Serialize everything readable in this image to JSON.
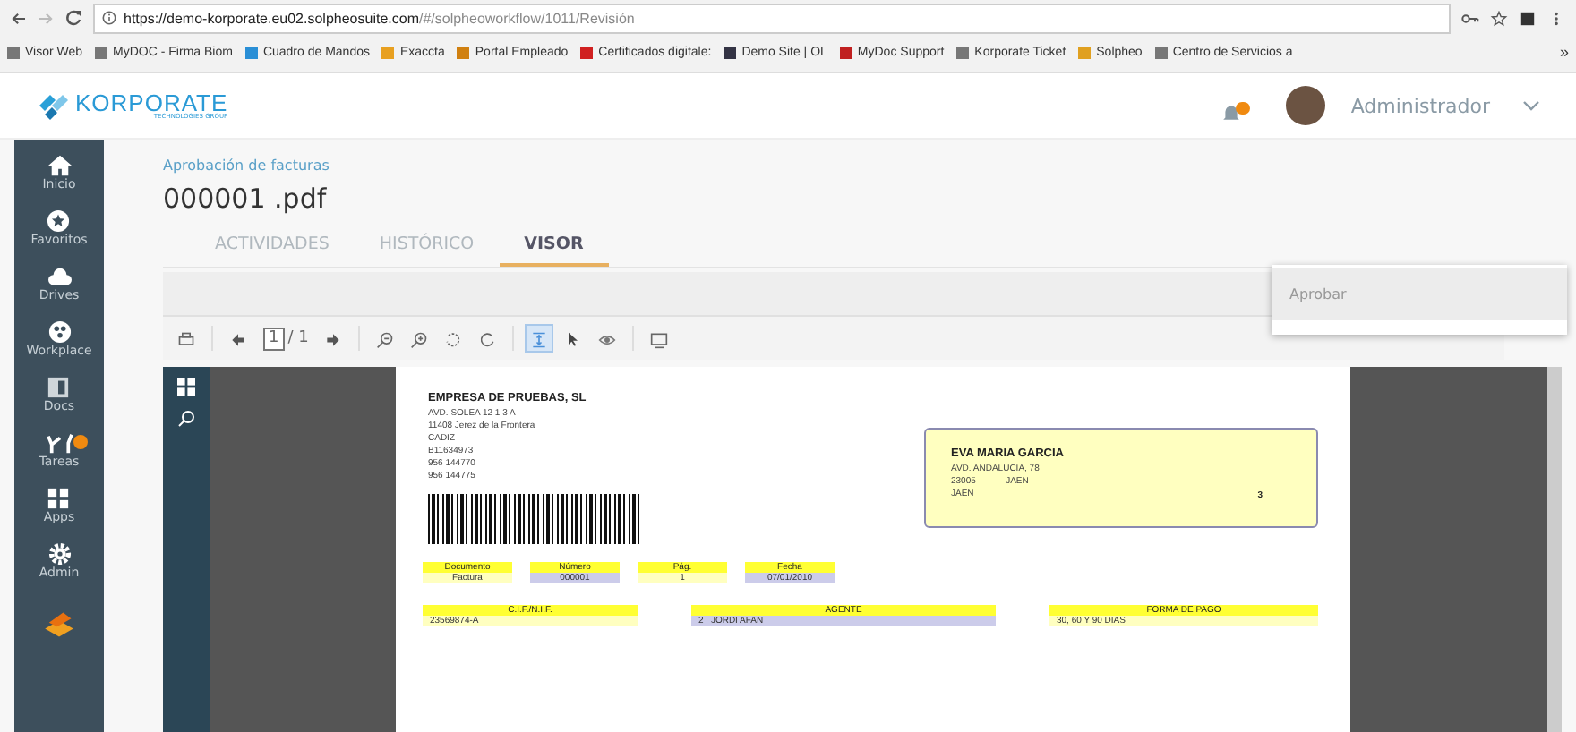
{
  "browser": {
    "url_host": "https://demo-korporate.eu02.solpheosuite.com",
    "url_path": "/#/solpheoworkflow/1011/Revisión",
    "bookmarks": [
      {
        "label": "Visor Web",
        "kind": "page"
      },
      {
        "label": "MyDOC - Firma Biom",
        "kind": "page"
      },
      {
        "label": "Cuadro de Mandos",
        "kind": "cloud"
      },
      {
        "label": "Exaccta",
        "kind": "folder"
      },
      {
        "label": "Portal Empleado",
        "kind": "person"
      },
      {
        "label": "Certificados digitale:",
        "kind": "cert"
      },
      {
        "label": "Demo Site | OL",
        "kind": "dark"
      },
      {
        "label": "MyDoc Support",
        "kind": "arc"
      },
      {
        "label": "Korporate Ticket",
        "kind": "page"
      },
      {
        "label": "Solpheo",
        "kind": "flame"
      },
      {
        "label": "Centro de Servicios a",
        "kind": "page"
      }
    ],
    "more": "»"
  },
  "header": {
    "logo": "KORPORATE",
    "logo_sub": "TECHNOLOGIES GROUP",
    "user": "Administrador"
  },
  "sidebar": {
    "items": [
      {
        "label": "Inicio",
        "kind": "home",
        "badge": false
      },
      {
        "label": "Favoritos",
        "kind": "star",
        "badge": false
      },
      {
        "label": "Drives",
        "kind": "cloud",
        "badge": false
      },
      {
        "label": "Workplace",
        "kind": "workplace",
        "badge": false
      },
      {
        "label": "Docs",
        "kind": "docs",
        "badge": false
      },
      {
        "label": "Tareas",
        "kind": "tasks",
        "badge": true
      },
      {
        "label": "Apps",
        "kind": "apps",
        "badge": false
      },
      {
        "label": "Admin",
        "kind": "gear",
        "badge": false
      }
    ]
  },
  "breadcrumb": "Aprobación de facturas",
  "title": "000001 .pdf",
  "tabs": [
    {
      "label": "ACTIVIDADES",
      "selected": false
    },
    {
      "label": "HISTÓRICO",
      "selected": false
    },
    {
      "label": "VISOR",
      "selected": true
    }
  ],
  "menu": {
    "items": [
      {
        "label": "Aprobar"
      }
    ]
  },
  "toolbar": {
    "page": "1",
    "total": "/ 1",
    "groups": [
      [
        {
          "kind": "print",
          "selected": false
        }
      ],
      [
        {
          "kind": "prev",
          "selected": false
        },
        {
          "kind": "pagebox",
          "selected": false
        },
        {
          "kind": "next",
          "selected": false
        }
      ],
      [
        {
          "kind": "zoomout",
          "selected": false
        },
        {
          "kind": "zoomin",
          "selected": false
        },
        {
          "kind": "rotl",
          "selected": false
        },
        {
          "kind": "rotr",
          "selected": false
        }
      ],
      [
        {
          "kind": "fit",
          "selected": true
        },
        {
          "kind": "pointer",
          "selected": false
        },
        {
          "kind": "eye",
          "selected": false
        }
      ],
      [
        {
          "kind": "screen",
          "selected": false
        }
      ]
    ]
  },
  "document": {
    "sender": {
      "name": "EMPRESA DE PRUEBAS, SL",
      "lines": [
        "AVD. SOLEA 12 1 3 A",
        "11408  Jerez de la Frontera",
        "CADIZ",
        "B11634973",
        "956 144770",
        "956 144775"
      ]
    },
    "recipient": {
      "name": "EVA MARIA GARCIA",
      "lines": [
        "AVD. ANDALUCIA, 78",
        "23005            JAEN",
        "JAEN"
      ],
      "number": "3"
    },
    "fields_1": [
      {
        "label": "Documento",
        "value": "Factura",
        "color": "#ffffc0"
      },
      {
        "label": "Número",
        "value": "000001",
        "color": "#ccccea"
      },
      {
        "label": "Pág.",
        "value": "1",
        "color": "#ffffc0"
      },
      {
        "label": "Fecha",
        "value": "07/01/2010",
        "color": "#ccccea"
      }
    ],
    "fields_2": [
      {
        "label": "C.I.F./N.I.F.",
        "value": "23569874-A",
        "color": "#ffffc0"
      },
      {
        "label": "AGENTE",
        "value": "2   JORDI AFAN",
        "color": "#ccccea"
      },
      {
        "label": "FORMA DE PAGO",
        "value": "30, 60 Y 90 DIAS",
        "color": "#ffffc0"
      }
    ]
  }
}
